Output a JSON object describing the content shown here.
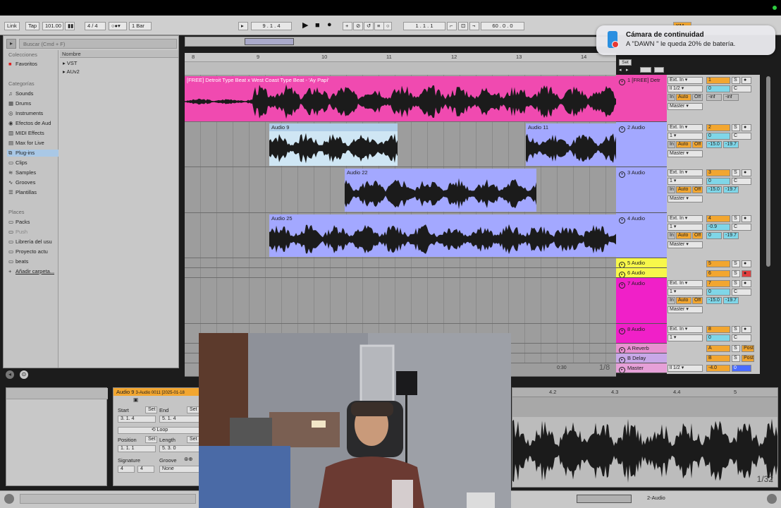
{
  "control_bar": {
    "link": "Link",
    "tap": "Tap",
    "tempo": "101.00",
    "signature": "4 / 4",
    "quant": "1 Bar",
    "position": "9 .  1 .  4",
    "position2": "1 .  1 .  1",
    "end_pos": "60 .  0 .  0"
  },
  "browser": {
    "search_placeholder": "Buscar (Cmd + F)",
    "collections_header": "Colecciones",
    "favorites": "Favoritos",
    "categories_header": "Categorías",
    "categories": [
      "Sounds",
      "Drums",
      "Instruments",
      "Efectos de Aud",
      "MIDI Effects",
      "Max for Live",
      "Plug-ins",
      "Clips",
      "Samples",
      "Grooves",
      "Plantillas"
    ],
    "places_header": "Places",
    "places": [
      "Packs",
      "Push",
      "Librería del usu",
      "Proyecto actu",
      "beats",
      "Añadir carpeta..."
    ],
    "name_col": "Nombre",
    "files": [
      "VST",
      "AUv2"
    ],
    "selected_category": "Plug-ins"
  },
  "ruler": {
    "bars": [
      "8",
      "9",
      "10",
      "11",
      "12",
      "13",
      "14"
    ],
    "set_label": "Set"
  },
  "tracks": [
    {
      "name": "1 [FREE] Detr",
      "color": "#f04ab0",
      "input": "Ext. In",
      "channel": "ll 1/2",
      "out": "Master",
      "num": "1",
      "vol": "0",
      "pan": "C",
      "inf1": "-inf",
      "inf2": "-inf"
    },
    {
      "name": "2 Audio",
      "color": "#a3a8ff",
      "input": "Ext. In",
      "channel": "1",
      "out": "Master",
      "num": "2",
      "vol": "0",
      "pan": "C",
      "peak1": "-15.0",
      "peak2": "-19.7"
    },
    {
      "name": "3 Audio",
      "color": "#a3a8ff",
      "input": "Ext. In",
      "channel": "1",
      "out": "Master",
      "num": "3",
      "vol": "0",
      "pan": "C",
      "peak1": "-15.0",
      "peak2": "-19.7"
    },
    {
      "name": "4 Audio",
      "color": "#a3a8ff",
      "input": "Ext. In",
      "channel": "1",
      "out": "Master",
      "num": "4",
      "vol": "-0.9",
      "pan": "C",
      "peak1": "0",
      "peak2": "-19.7"
    },
    {
      "name": "5 Audio",
      "color": "#f7f74a",
      "num": "5"
    },
    {
      "name": "6 Audio",
      "color": "#f7f74a",
      "num": "6"
    },
    {
      "name": "7 Audio",
      "color": "#f020c8",
      "input": "Ext. In",
      "channel": "1",
      "out": "Master",
      "num": "7",
      "vol": "0",
      "pan": "C",
      "peak1": "-15.0",
      "peak2": "-19.7"
    },
    {
      "name": "8 Audio",
      "color": "#f020c8",
      "input": "Ext. In",
      "channel": "1",
      "num": "8",
      "vol": "0",
      "pan": "C"
    }
  ],
  "returns": [
    {
      "name": "A Reverb",
      "letter": "A",
      "color": "#e890d0"
    },
    {
      "name": "B Delay",
      "letter": "B",
      "color": "#c8a8e8"
    }
  ],
  "master": {
    "name": "Master",
    "channel": "ll 1/2",
    "vol": "-4.0",
    "pan": "0"
  },
  "io_labels": {
    "in": "In",
    "auto": "Auto",
    "off": "Off",
    "s": "S",
    "c": "C",
    "post": "Post"
  },
  "clips": [
    {
      "name": "[FREE] Detroit Type Beat x West Coast Type Beat - 'Ay Papi'"
    },
    {
      "name": "Audio 9"
    },
    {
      "name": "Audio 11"
    },
    {
      "name": "Audio 22"
    },
    {
      "name": "Audio 25"
    }
  ],
  "arrangement": {
    "page": "1/8",
    "time": "0:30"
  },
  "clip_detail": {
    "title": "Audio 9",
    "subtitle": "3-Audio 0011 [2025-01-18",
    "start_label": "Start",
    "end_label": "End",
    "set": "Set",
    "start_val": "3.  1.  4",
    "end_val": "5.  1.  4",
    "loop": "Loop",
    "position_label": "Position",
    "length_label": "Length",
    "position_val": "1.  1.  1",
    "length_val": "5.  3.  0",
    "signature_label": "Signature",
    "groove_label": "Groove",
    "sig_num": "4",
    "sig_den": "4",
    "groove_val": "None"
  },
  "sample_view": {
    "marks": [
      "4.2",
      "4.3",
      "4.4",
      "5"
    ],
    "zoom": "1/32"
  },
  "status": {
    "track_label": "2-Audio"
  },
  "notification": {
    "title": "Cámara de continuidad",
    "message": "A \"DAWN \" le queda 20% de batería."
  }
}
